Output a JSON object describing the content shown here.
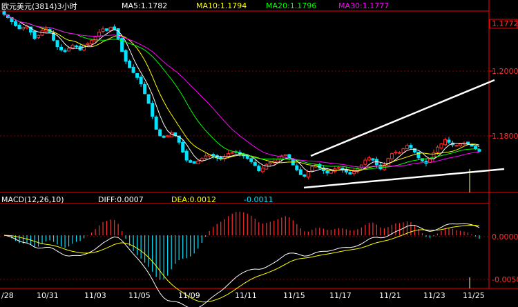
{
  "header": {
    "symbol": "欧元美元(3814)3小时",
    "ma5": "MA5:1.1782",
    "ma10": "MA10:1.1794",
    "ma20": "MA20:1.1796",
    "ma30": "MA30:1.1777"
  },
  "macd_header": {
    "name": "MACD(12,26,10)",
    "diff": "DIFF:0.0007",
    "dea": "DEA:0.0012",
    "macd": "-0.0011"
  },
  "colors": {
    "background": "#000000",
    "grid": "#8b0000",
    "frame": "#ff0000",
    "candle_up": "#ff3030",
    "candle_down": "#00e5ff",
    "ma5": "#ffffff",
    "ma10": "#ffff00",
    "ma20": "#00ff00",
    "ma30": "#ff00ff",
    "diff": "#ffffff",
    "dea": "#ffff00",
    "trendline": "#ffffff"
  },
  "chart_data": [
    {
      "type": "candlestick",
      "title": "欧元美元(3814)3小时",
      "x_labels": [
        "/28",
        "10/31",
        "11/03",
        "11/05",
        "11/09",
        "11/11",
        "11/15",
        "11/17",
        "11/21",
        "11/23",
        "11/25"
      ],
      "price_axis": {
        "ticks": [
          1.2,
          1.18
        ],
        "tick_labels": [
          "1.2000",
          "1.1800"
        ],
        "current_price_label": "1.1772",
        "ylim": [
          1.1645,
          1.2205
        ]
      },
      "close_series": [
        1.2195,
        1.2185,
        1.2172,
        1.216,
        1.215,
        1.2155,
        1.2158,
        1.214,
        1.212,
        1.213,
        1.2145,
        1.215,
        1.214,
        1.2115,
        1.2095,
        1.2085,
        1.208,
        1.209,
        1.21,
        1.2095,
        1.2085,
        1.21,
        1.2105,
        1.2115,
        1.2125,
        1.214,
        1.215,
        1.2145,
        1.2155,
        1.2148,
        1.212,
        1.208,
        1.205,
        1.203,
        1.2015,
        1.2,
        1.198,
        1.195,
        1.192,
        1.188,
        1.184,
        1.182,
        1.1815,
        1.182,
        1.183,
        1.182,
        1.18,
        1.177,
        1.1745,
        1.1738,
        1.1735,
        1.1742,
        1.175,
        1.1758,
        1.1762,
        1.1758,
        1.1752,
        1.1748,
        1.1756,
        1.1765,
        1.1768,
        1.177,
        1.1763,
        1.1758,
        1.175,
        1.174,
        1.1728,
        1.1712,
        1.172,
        1.1732,
        1.1738,
        1.1742,
        1.1748,
        1.1758,
        1.1762,
        1.1748,
        1.173,
        1.1715,
        1.17,
        1.1695,
        1.171,
        1.1725,
        1.173,
        1.172,
        1.1712,
        1.1705,
        1.1712,
        1.1718,
        1.1722,
        1.1715,
        1.1708,
        1.1702,
        1.171,
        1.172,
        1.173,
        1.1745,
        1.1752,
        1.1745,
        1.173,
        1.1718,
        1.173,
        1.175,
        1.1765,
        1.177,
        1.1768,
        1.178,
        1.179,
        1.1783,
        1.177,
        1.1752,
        1.1742,
        1.1735,
        1.1748,
        1.1768,
        1.1785,
        1.1795,
        1.1808,
        1.18,
        1.1792,
        1.179,
        1.1795,
        1.1798,
        1.1795,
        1.1788,
        1.178,
        1.1772
      ],
      "ma_current": {
        "MA5": 1.1782,
        "MA10": 1.1794,
        "MA20": 1.1796,
        "MA30": 1.1777
      }
    },
    {
      "type": "macd",
      "title": "MACD(12,26,10)",
      "axis": {
        "ticks": [
          0.0,
          -0.005
        ],
        "tick_labels": [
          "0.0000",
          "-0.0050"
        ],
        "ylim": [
          -0.0064,
          0.0038
        ]
      },
      "current": {
        "DIFF": 0.0007,
        "DEA": 0.0012,
        "MACD": -0.0011
      }
    }
  ]
}
